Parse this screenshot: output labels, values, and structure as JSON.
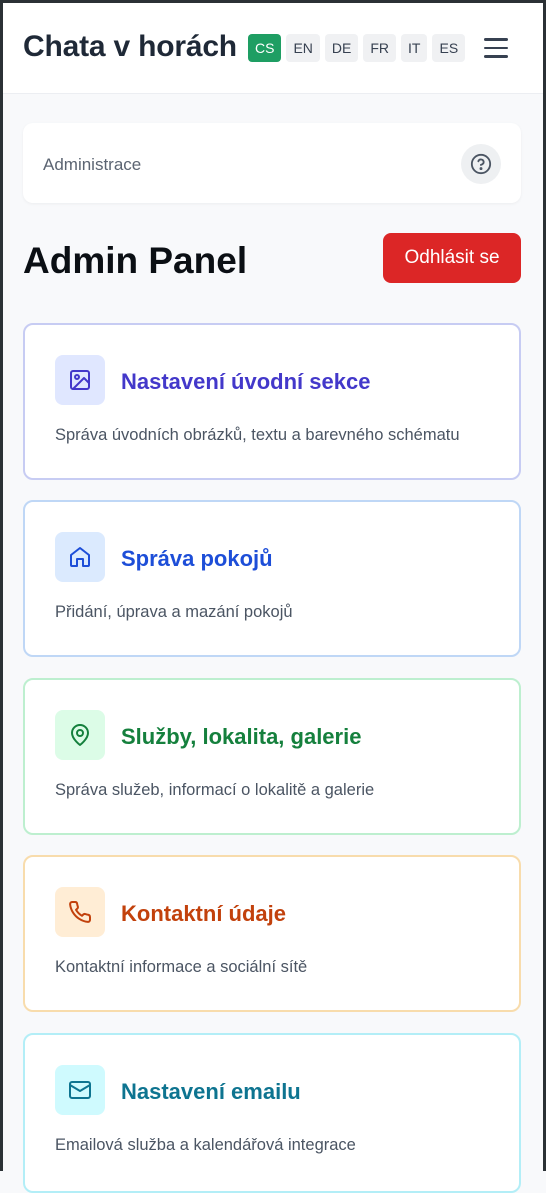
{
  "header": {
    "site_title": "Chata v horách",
    "languages": [
      "CS",
      "EN",
      "DE",
      "FR",
      "IT",
      "ES"
    ],
    "active_language": "CS",
    "menu_icon": "hamburger-menu-icon"
  },
  "breadcrumb": {
    "label": "Administrace",
    "help_icon": "help-circle-icon"
  },
  "page": {
    "title": "Admin Panel",
    "logout_label": "Odhlásit se"
  },
  "cards": [
    {
      "title": "Nastavení úvodní sekce",
      "description": "Správa úvodních obrázků, textu a barevného schématu",
      "icon": "image-icon",
      "color": "#4338ca",
      "bg": "#e0e7ff",
      "border": "#c7ccf3"
    },
    {
      "title": "Správa pokojů",
      "description": "Přidání, úprava a mazání pokojů",
      "icon": "home-icon",
      "color": "#1d4ed8",
      "bg": "#dbeafe",
      "border": "#bfd7f6"
    },
    {
      "title": "Služby, lokalita, galerie",
      "description": "Správa služeb, informací o lokalitě a galerie",
      "icon": "map-pin-icon",
      "color": "#15803d",
      "bg": "#dcfce7",
      "border": "#bdefcf"
    },
    {
      "title": "Kontaktní údaje",
      "description": "Kontaktní informace a sociální sítě",
      "icon": "phone-icon",
      "color": "#c2410c",
      "bg": "#ffedd5",
      "border": "#f8dcac"
    },
    {
      "title": "Nastavení emailu",
      "description": "Emailová služba a kalendářová integrace",
      "icon": "mail-icon",
      "color": "#0e7490",
      "bg": "#cffafe",
      "border": "#b3eef7"
    }
  ]
}
